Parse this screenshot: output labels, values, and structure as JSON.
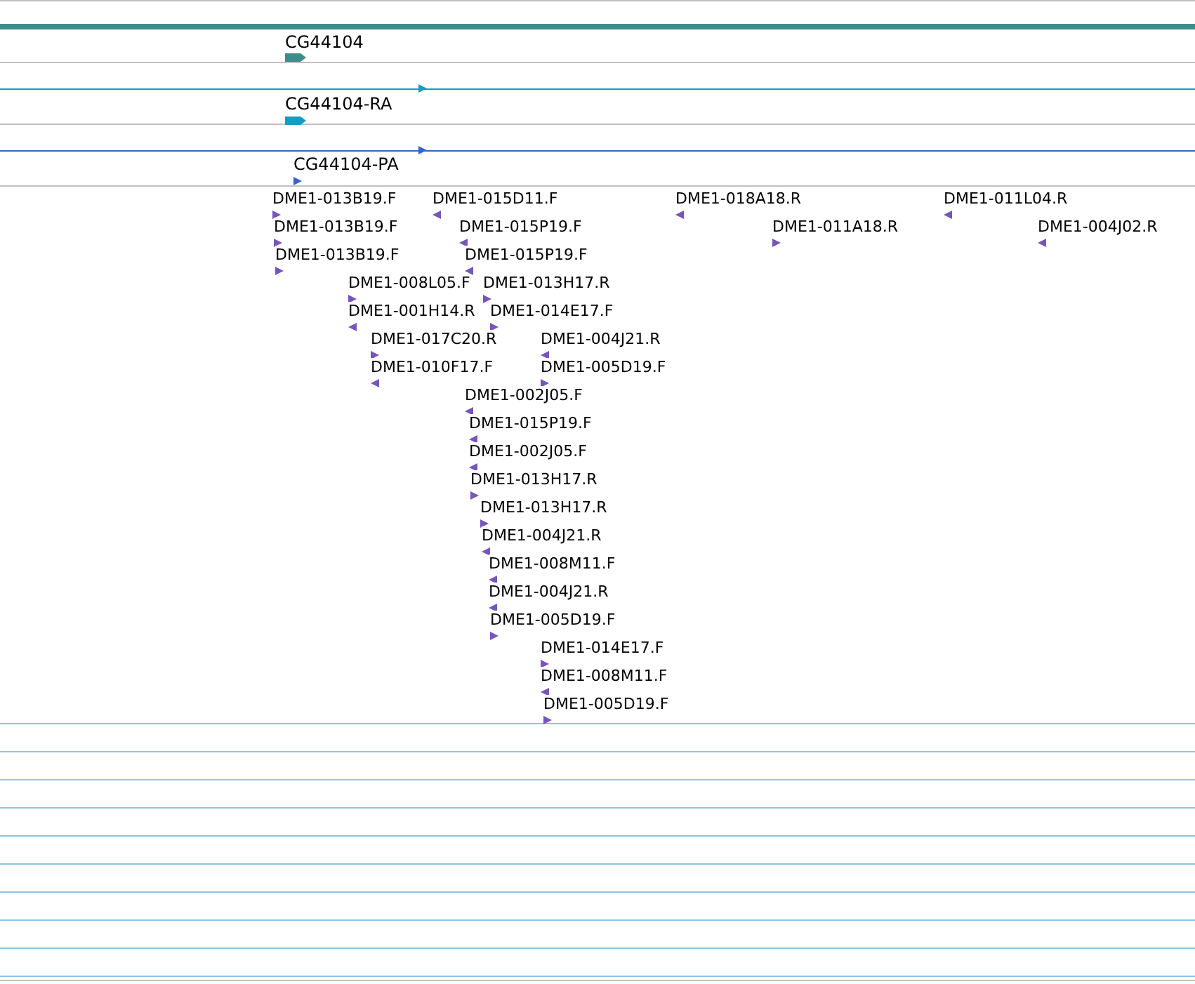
{
  "gene_track": {
    "label": "CG44104",
    "reverse": false
  },
  "transcript_tracks": [
    {
      "label": "CG44104-RA",
      "reverse": false,
      "color": "#119ec0"
    },
    {
      "label": "CG44104-PA",
      "reverse": false,
      "color": "#3366cc"
    }
  ],
  "features": [
    {
      "label": "DME1-013B19.F",
      "reverse": false
    },
    {
      "label": "DME1-015D11.F",
      "reverse": true
    },
    {
      "label": "DME1-018A18.R",
      "reverse": true
    },
    {
      "label": "DME1-011L04.R",
      "reverse": true
    },
    {
      "label": "DME1-013B19.F",
      "reverse": false
    },
    {
      "label": "DME1-015P19.F",
      "reverse": true
    },
    {
      "label": "DME1-011A18.R",
      "reverse": false
    },
    {
      "label": "DME1-004J02.R",
      "reverse": true
    },
    {
      "label": "DME1-013B19.F",
      "reverse": false
    },
    {
      "label": "DME1-015P19.F",
      "reverse": true
    },
    {
      "label": "DME1-008L05.F",
      "reverse": false
    },
    {
      "label": "DME1-013H17.R",
      "reverse": false
    },
    {
      "label": "DME1-001H14.R",
      "reverse": true
    },
    {
      "label": "DME1-014E17.F",
      "reverse": false
    },
    {
      "label": "DME1-017C20.R",
      "reverse": false
    },
    {
      "label": "DME1-004J21.R",
      "reverse": true
    },
    {
      "label": "DME1-010F17.F",
      "reverse": true
    },
    {
      "label": "DME1-005D19.F",
      "reverse": false
    },
    {
      "label": "DME1-002J05.F",
      "reverse": true
    },
    {
      "label": "DME1-015P19.F",
      "reverse": true
    },
    {
      "label": "DME1-002J05.F",
      "reverse": true
    },
    {
      "label": "DME1-013H17.R",
      "reverse": false
    },
    {
      "label": "DME1-013H17.R",
      "reverse": false
    },
    {
      "label": "DME1-004J21.R",
      "reverse": true
    },
    {
      "label": "DME1-008M11.F",
      "reverse": true
    },
    {
      "label": "DME1-004J21.R",
      "reverse": true
    },
    {
      "label": "DME1-005D19.F",
      "reverse": false
    },
    {
      "label": "DME1-014E17.F",
      "reverse": false
    },
    {
      "label": "DME1-008M11.F",
      "reverse": true
    },
    {
      "label": "DME1-005D19.F",
      "reverse": false
    }
  ]
}
